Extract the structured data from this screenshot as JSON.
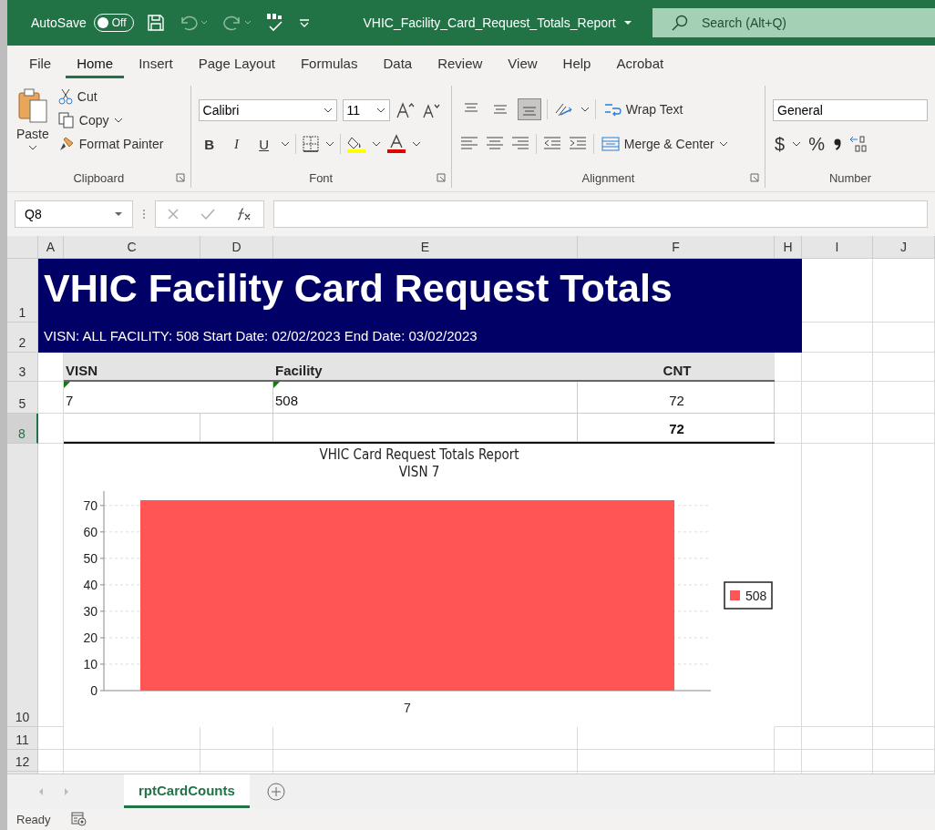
{
  "title_bar": {
    "autosave_label": "AutoSave",
    "autosave": {
      "label": "Off",
      "on": false
    },
    "file_name": "VHIC_Facility_Card_Request_Totals_Report",
    "search": {
      "placeholder": "Search (Alt+Q)"
    }
  },
  "ribbon_tabs": [
    {
      "label": "File",
      "selected": false
    },
    {
      "label": "Home",
      "selected": true
    },
    {
      "label": "Insert",
      "selected": false
    },
    {
      "label": "Page Layout",
      "selected": false
    },
    {
      "label": "Formulas",
      "selected": false
    },
    {
      "label": "Data",
      "selected": false
    },
    {
      "label": "Review",
      "selected": false
    },
    {
      "label": "View",
      "selected": false
    },
    {
      "label": "Help",
      "selected": false
    },
    {
      "label": "Acrobat",
      "selected": false
    }
  ],
  "ribbon": {
    "clipboard": {
      "paste": "Paste",
      "cut": "Cut",
      "copy": "Copy",
      "format_painter": "Format Painter",
      "label": "Clipboard"
    },
    "font": {
      "name": "Calibri",
      "size": "11",
      "bold": "B",
      "italic": "I",
      "underline": "U",
      "label": "Font"
    },
    "alignment": {
      "vertical": [
        {
          "selected": false
        },
        {
          "selected": false
        },
        {
          "selected": true
        }
      ],
      "wrap_text": "Wrap Text",
      "merge_center": "Merge & Center",
      "label": "Alignment"
    },
    "number": {
      "format": "General",
      "currency": "$",
      "percent": "%",
      "label": "Number"
    }
  },
  "formula_bar": {
    "name_box": "Q8"
  },
  "columns": [
    "A",
    "C",
    "D",
    "E",
    "F",
    "H",
    "I",
    "J"
  ],
  "rows": [
    {
      "label": "1",
      "selected": false
    },
    {
      "label": "2",
      "selected": false
    },
    {
      "label": "3",
      "selected": false
    },
    {
      "label": "5",
      "selected": false
    },
    {
      "label": "8",
      "selected": true
    },
    {
      "label": "10",
      "selected": false
    },
    {
      "label": "11",
      "selected": false
    },
    {
      "label": "12",
      "selected": false
    }
  ],
  "report": {
    "title": "VHIC Facility Card Request Totals",
    "subtitle": "VISN: ALL FACILITY: 508 Start Date: 02/02/2023 End Date: 03/02/2023",
    "headers": [
      "VISN",
      "Facility",
      "CNT"
    ],
    "rows": [
      [
        "7",
        "508",
        "72"
      ]
    ],
    "total": "72"
  },
  "chart": {
    "subtitle": "VISN 7",
    "chart_data": {
      "type": "bar",
      "title": "VHIC Card Request Totals Report",
      "categories": [
        "7"
      ],
      "series": [
        {
          "name": "508",
          "color": "#ff5555",
          "values": [
            72
          ]
        }
      ],
      "ylim": [
        0,
        72
      ],
      "grid": true,
      "yticks": [
        0,
        10,
        20,
        30,
        40,
        50,
        60,
        70
      ]
    }
  },
  "sheet_tabs": [
    {
      "label": "rptCardCounts",
      "selected": true
    }
  ],
  "status_bar": {
    "text": "Ready"
  }
}
